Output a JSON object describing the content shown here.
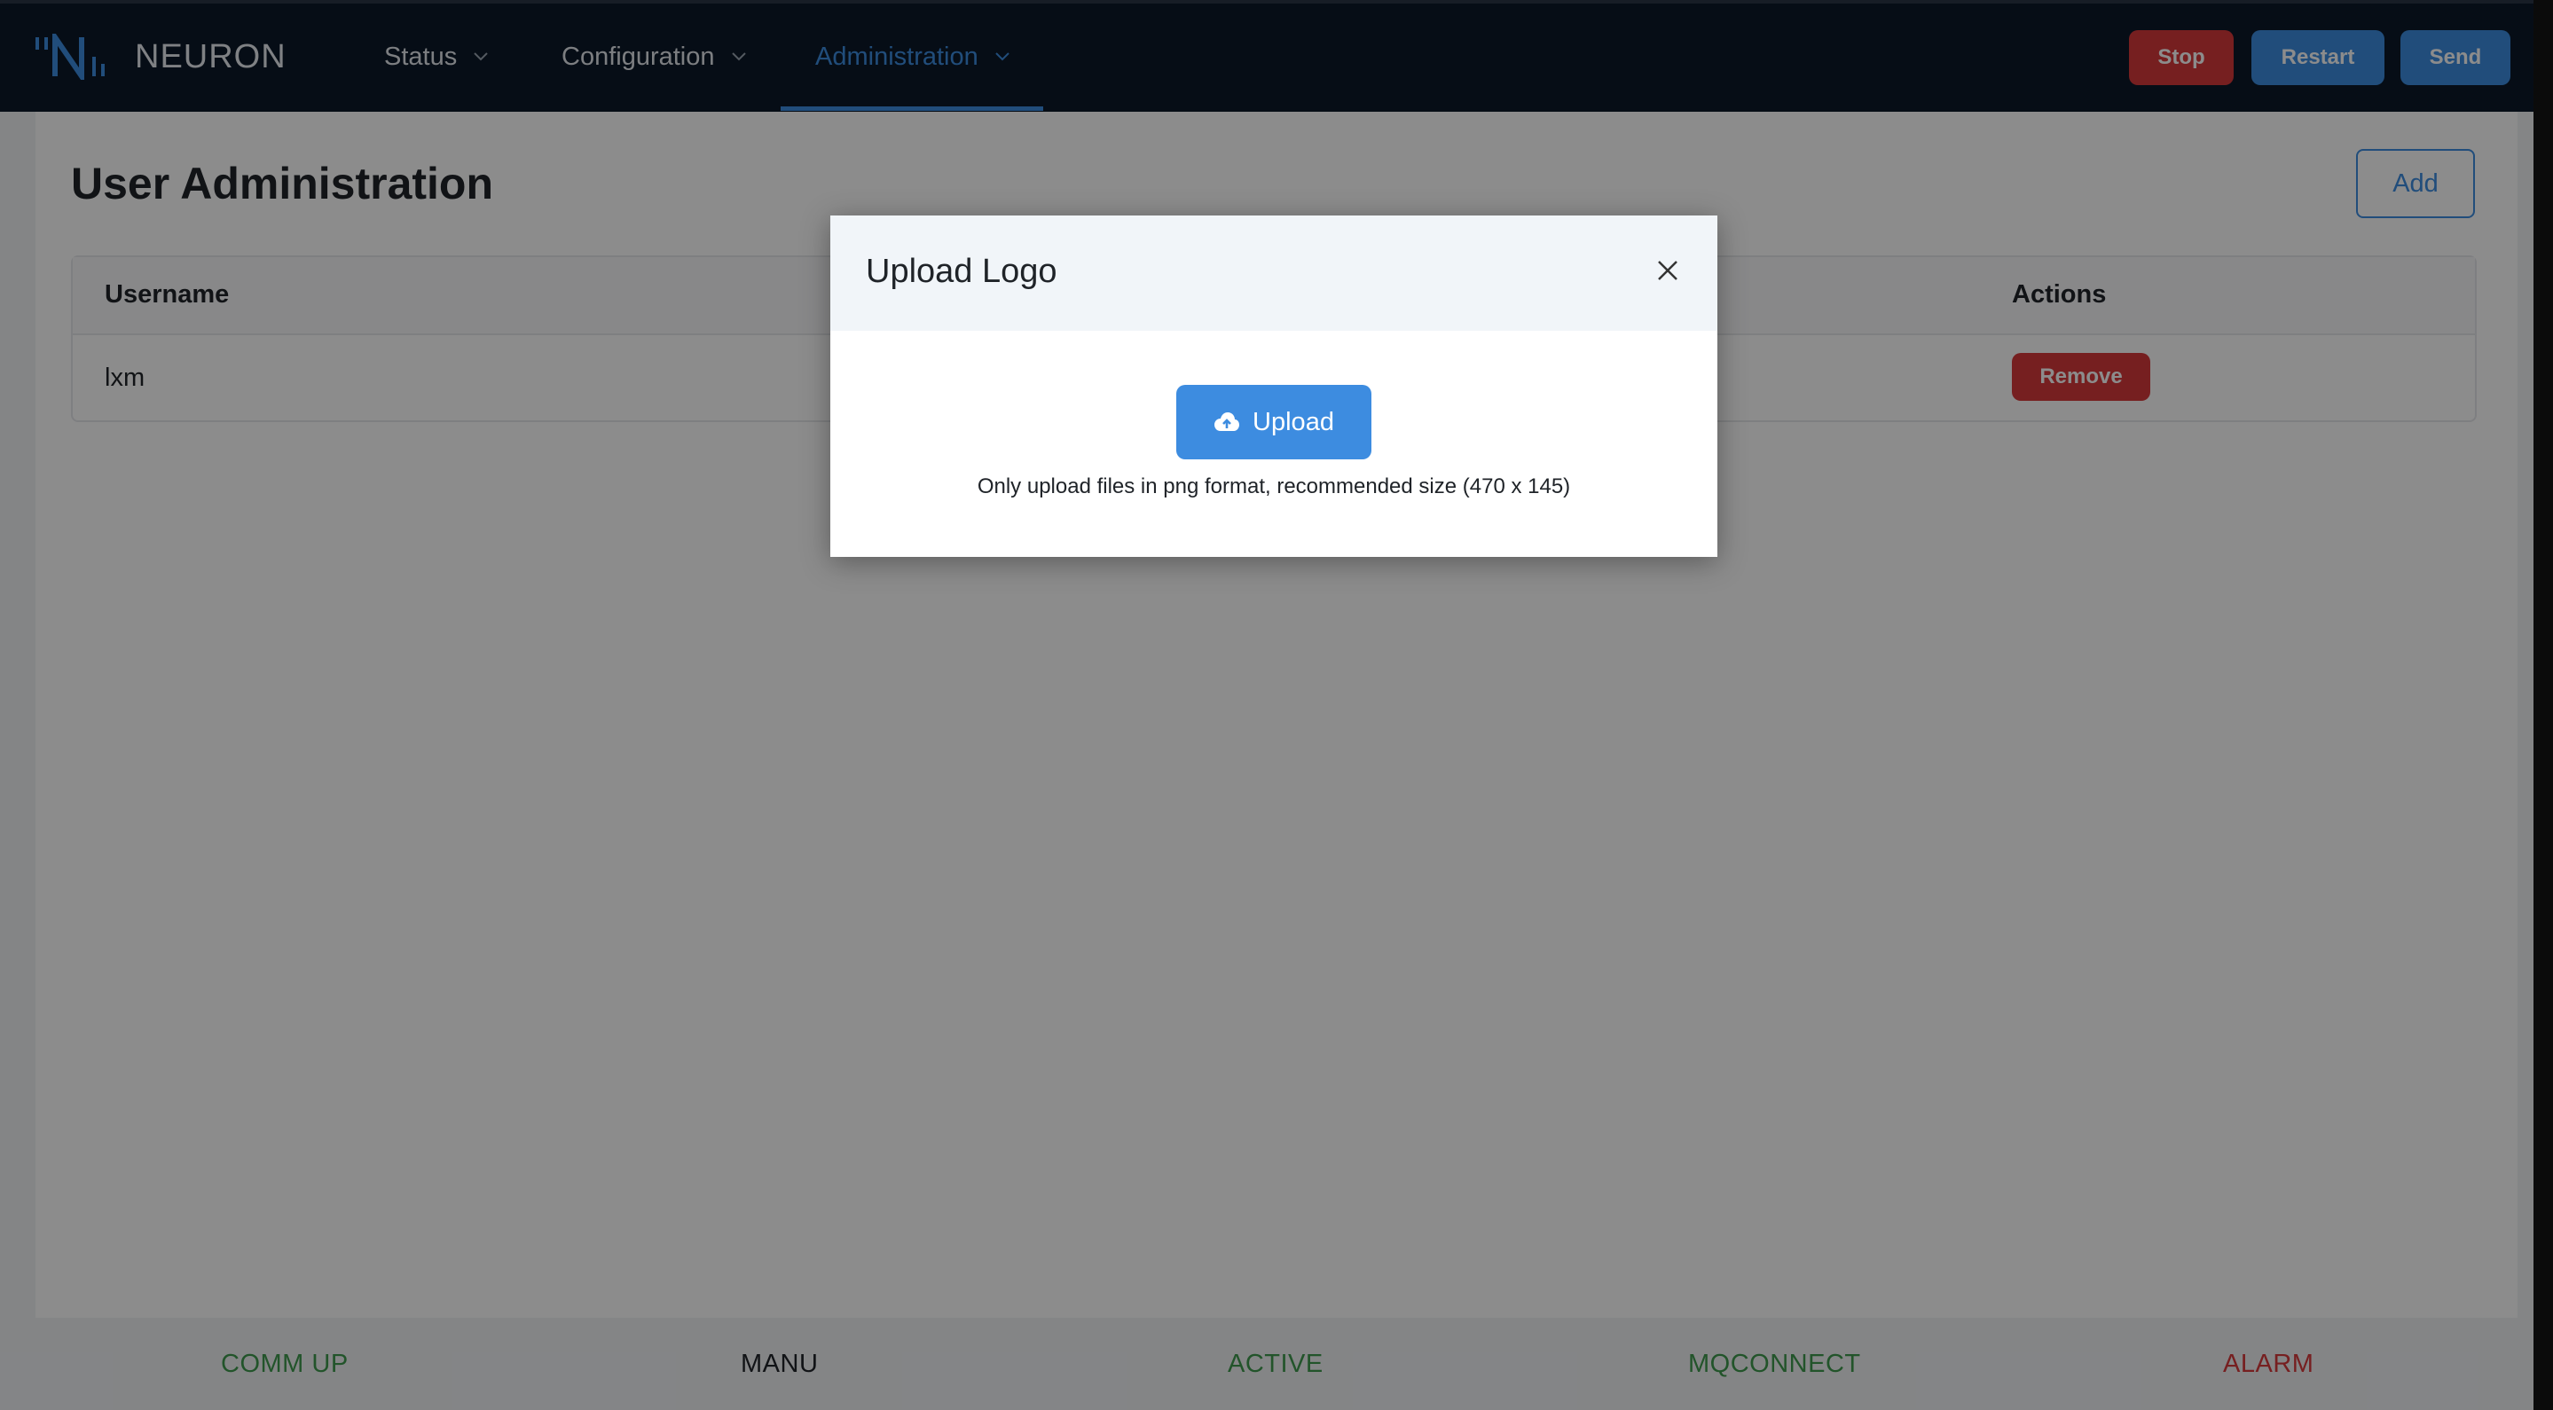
{
  "app": {
    "brand": "NEURON"
  },
  "nav": {
    "items": [
      {
        "label": "Status"
      },
      {
        "label": "Configuration"
      },
      {
        "label": "Administration"
      }
    ],
    "active": "Administration"
  },
  "header_buttons": {
    "stop": "Stop",
    "restart": "Restart",
    "send": "Send"
  },
  "page": {
    "title": "User Administration",
    "add_label": "Add"
  },
  "table": {
    "columns": [
      "Username",
      "Actions"
    ],
    "rows": [
      {
        "username": "lxm",
        "action": "Remove"
      }
    ]
  },
  "modal": {
    "title": "Upload Logo",
    "upload_label": "Upload",
    "hint": "Only upload files in png format, recommended size (470 x 145)"
  },
  "statusbar": {
    "items": [
      {
        "label": "COMM UP",
        "color": "#3f9a4e"
      },
      {
        "label": "MANU",
        "color": "#1f2328"
      },
      {
        "label": "ACTIVE",
        "color": "#3f9a4e"
      },
      {
        "label": "MQCONNECT",
        "color": "#3f9a4e"
      },
      {
        "label": "ALARM",
        "color": "#d8393b"
      }
    ]
  },
  "colors": {
    "header_bg": "#0b1929",
    "accent": "#3d8ce0",
    "danger": "#d8393b"
  }
}
